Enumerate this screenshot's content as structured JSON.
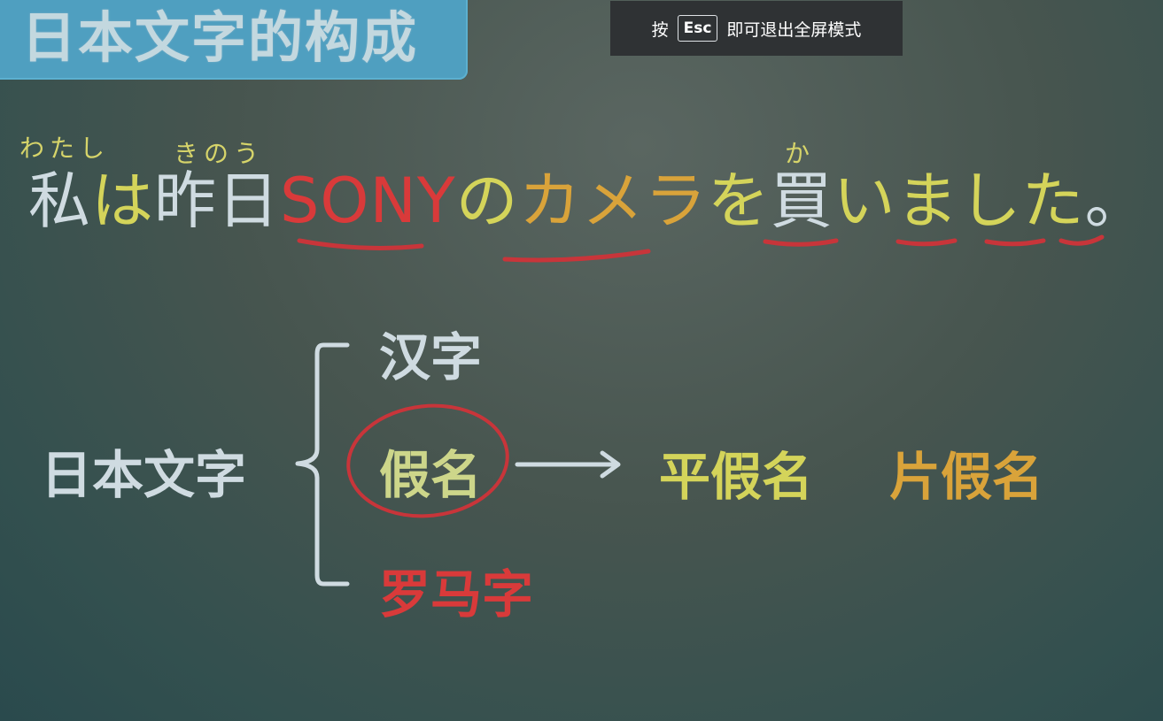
{
  "slide": {
    "title": "日本文字的构成",
    "furigana": {
      "watashi": "わたし",
      "kinou": "きのう",
      "ka": "か"
    },
    "sentence": {
      "watashi_kanji": "私",
      "wa": "は",
      "kinou_kanji": "昨日",
      "sony": "SONY",
      "no": "の",
      "camera": "カメラ",
      "wo": "を",
      "ka_kanji": "買",
      "imashita": "いました",
      "period": "。"
    },
    "diagram": {
      "root": "日本文字",
      "branch_kanji": "汉字",
      "branch_kana": "假名",
      "branch_romaji": "罗马字",
      "hiragana": "平假名",
      "katakana": "片假名"
    }
  },
  "fullscreen_notice": {
    "prefix": "按",
    "key": "Esc",
    "suffix": "即可退出全屏模式"
  },
  "colors": {
    "chalk_white": "#cfdbe1",
    "chalk_yellow": "#d4d45a",
    "chalk_red": "#d93a3a",
    "chalk_orange": "#d9a33a",
    "title_tab": "#4f9fc0"
  }
}
